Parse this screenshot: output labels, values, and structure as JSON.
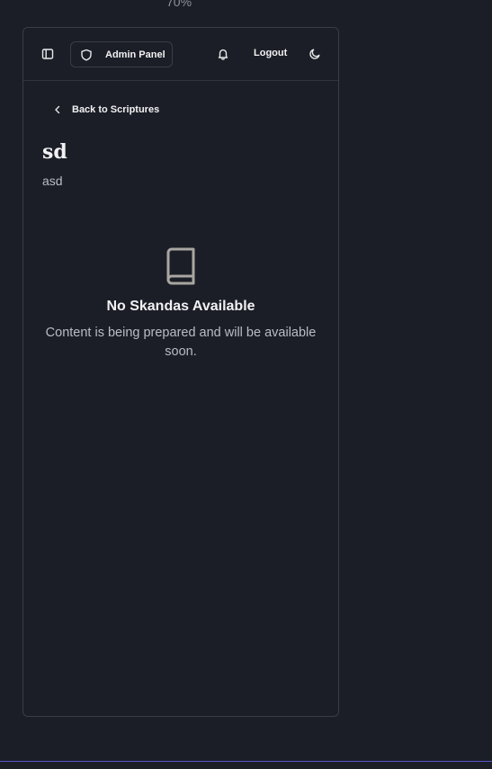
{
  "zoom": {
    "label": "70%"
  },
  "header": {
    "admin_label": "Admin Panel",
    "logout_label": "Logout"
  },
  "nav": {
    "back_label": "Back to Scriptures"
  },
  "page": {
    "title": "sd",
    "subtitle": "asd"
  },
  "empty_state": {
    "heading": "No Skandas Available",
    "description": "Content is being prepared and will be available soon."
  },
  "colors": {
    "background": "#1b1e26",
    "accent_line": "#5a54c8",
    "border": "#3a3d45"
  }
}
